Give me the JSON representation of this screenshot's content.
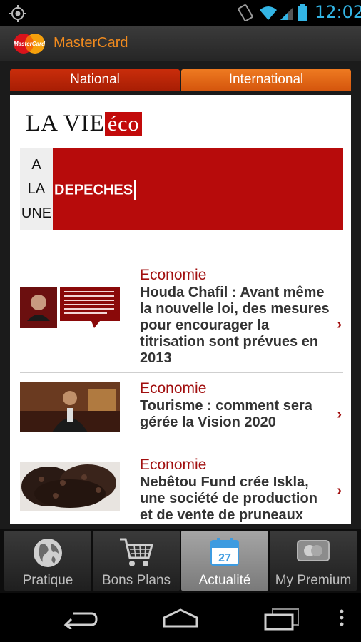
{
  "status_bar": {
    "time": "12:02"
  },
  "app": {
    "title": "MasterCard",
    "logo_text": "MasterCard"
  },
  "tabs": [
    {
      "label": "National",
      "active": true
    },
    {
      "label": "International",
      "active": false
    }
  ],
  "brand": {
    "main": "LA VIE",
    "accent": "éco"
  },
  "une": {
    "label_lines": [
      "A",
      "LA",
      "UNE"
    ],
    "text": "DEPECHES"
  },
  "articles": [
    {
      "category": "Economie",
      "headline": "Houda Chafil : Avant même la nouvelle loi, des mesures pour encourager la titrisation sont prévues en 2013"
    },
    {
      "category": "Economie",
      "headline": "Tourisme : comment sera gérée la Vision 2020"
    },
    {
      "category": "Economie",
      "headline": "Nebêtou Fund crée Iskla, une société de production et de vente de pruneaux"
    }
  ],
  "bottom_tabs": [
    {
      "label": "Pratique",
      "icon": "globe-icon",
      "selected": false
    },
    {
      "label": "Bons Plans",
      "icon": "cart-icon",
      "selected": false
    },
    {
      "label": "Actualité",
      "icon": "calendar-icon",
      "selected": true,
      "icon_text": "27"
    },
    {
      "label": "My Premium",
      "icon": "card-icon",
      "selected": false
    }
  ],
  "colors": {
    "accent": "#f08a1e",
    "red": "#b70b0b",
    "link_red": "#a10f0f",
    "clock": "#33b5e5"
  }
}
